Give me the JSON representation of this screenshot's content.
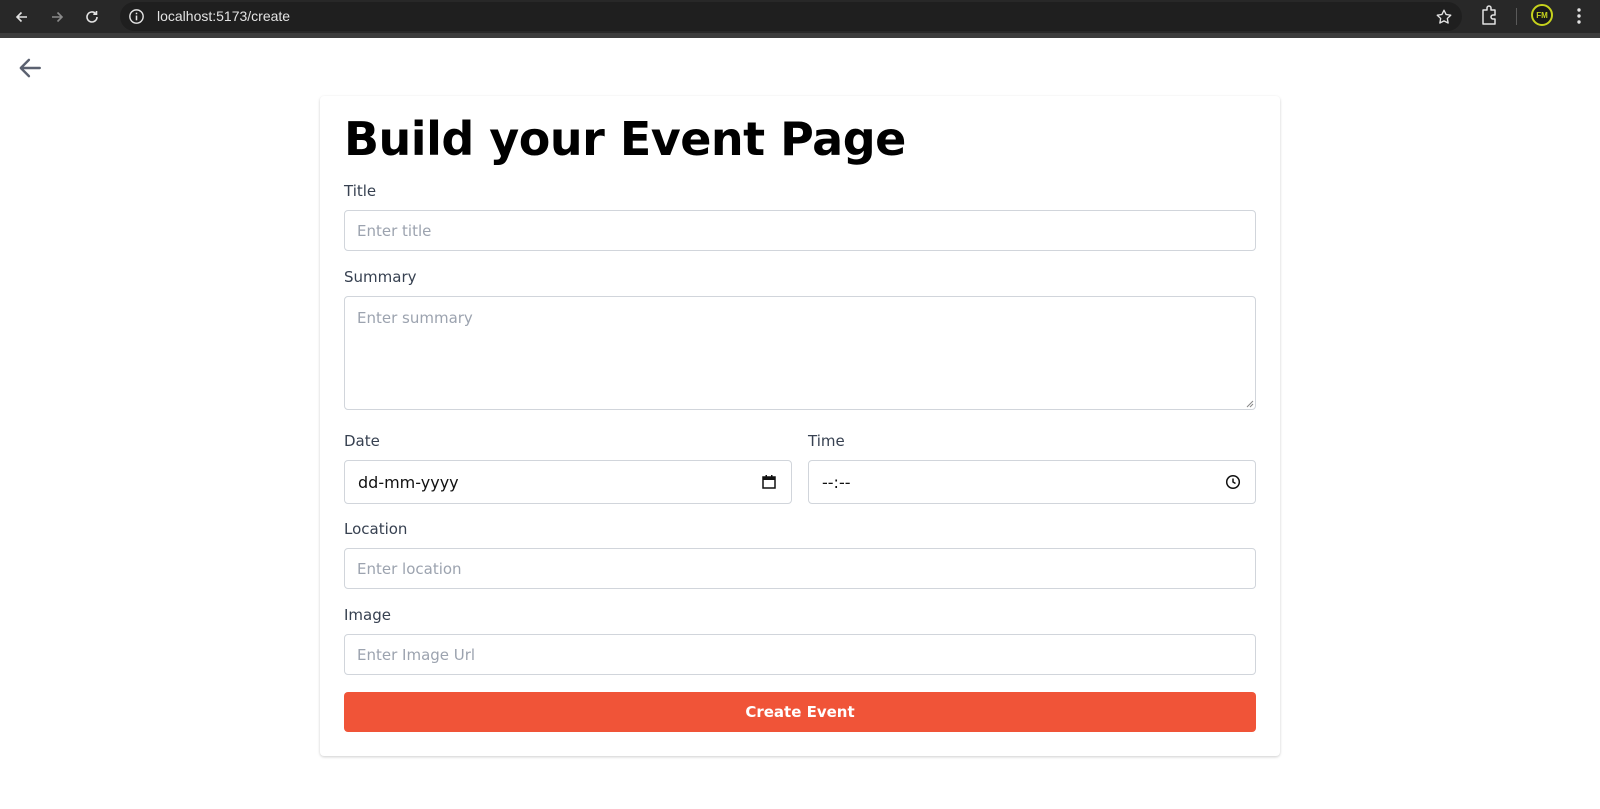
{
  "browser": {
    "url": "localhost:5173/create",
    "profile_initials": "FM",
    "icons": [
      "back-icon",
      "forward-icon",
      "reload-icon",
      "info-icon",
      "star-icon",
      "extensions-icon",
      "profile-avatar",
      "more-menu-icon"
    ]
  },
  "page": {
    "back_icon": "arrow-left-icon",
    "heading": "Build your Event Page",
    "form": {
      "title_label": "Title",
      "title_placeholder": "Enter title",
      "summary_label": "Summary",
      "summary_placeholder": "Enter summary",
      "date_label": "Date",
      "date_value": "dd-mm-yyyy",
      "time_label": "Time",
      "time_value": "--:--",
      "location_label": "Location",
      "location_placeholder": "Enter location",
      "image_label": "Image",
      "image_placeholder": "Enter Image Url",
      "submit_label": "Create Event"
    }
  },
  "colors": {
    "accent": "#f05438",
    "chrome_bg": "#282828",
    "border": "#d1d5db"
  }
}
